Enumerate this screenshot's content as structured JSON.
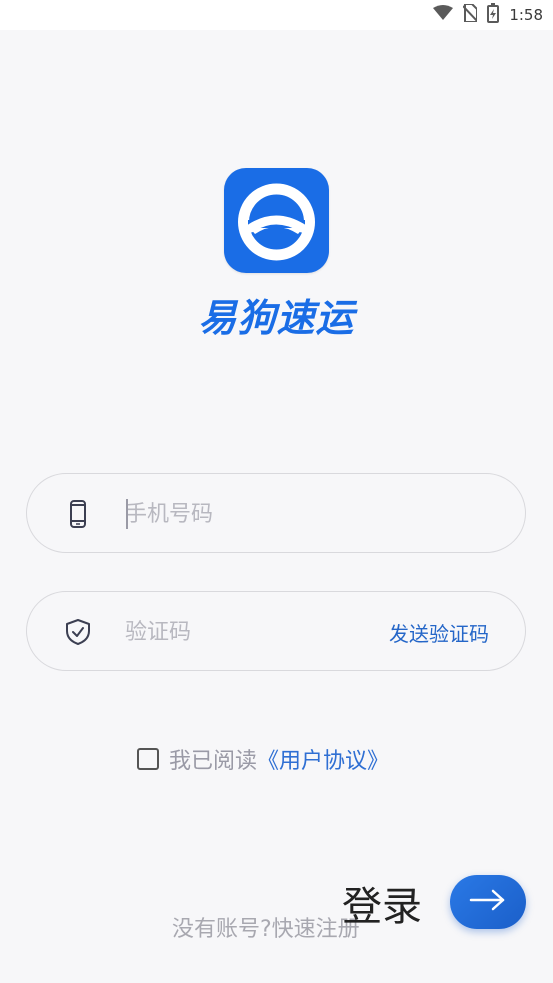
{
  "status_bar": {
    "time": "1:58",
    "icons": [
      "wifi-icon",
      "no-sim-icon",
      "battery-charging-icon"
    ]
  },
  "app": {
    "name": "易狗速运",
    "logo_icon": "steering-wheel-logo",
    "brand_color": "#1a6de6"
  },
  "phone_field": {
    "placeholder": "手机号码",
    "value": "",
    "icon": "phone-icon"
  },
  "code_field": {
    "placeholder": "验证码",
    "value": "",
    "icon": "shield-check-icon",
    "send_label": "发送验证码"
  },
  "agreement": {
    "checked": false,
    "text": "我已阅读",
    "link": "《用户协议》"
  },
  "register_link": "没有账号?快速注册",
  "login": {
    "label": "登录",
    "button_icon": "arrow-right-icon"
  }
}
